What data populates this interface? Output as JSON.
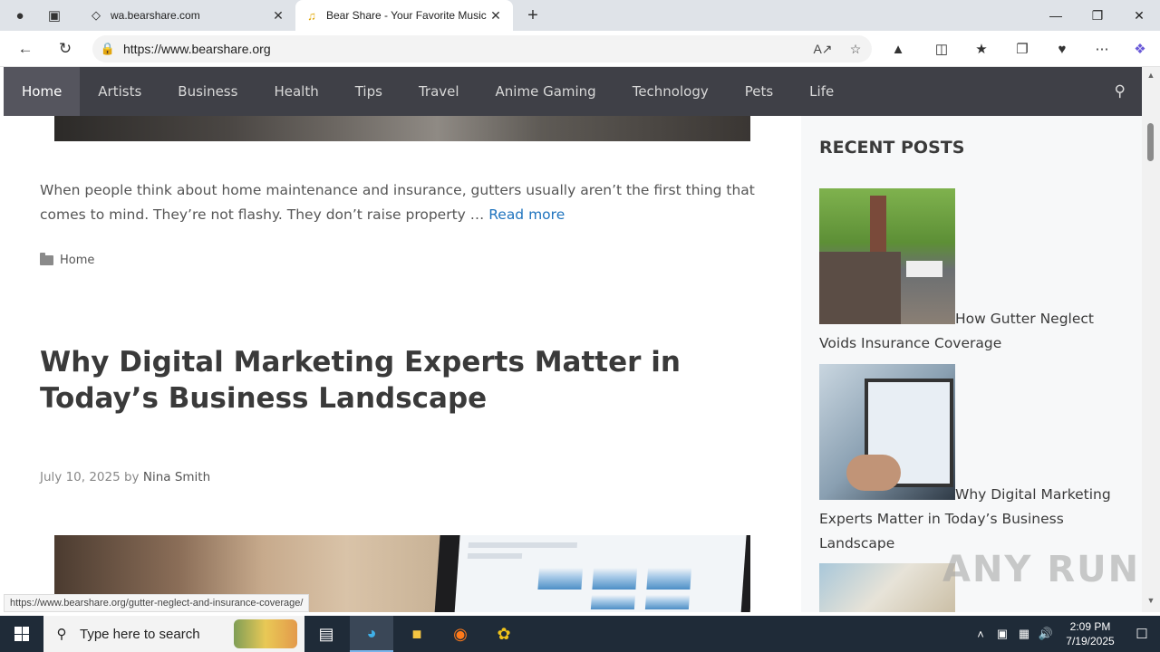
{
  "browser": {
    "tabs": [
      {
        "title": "wa.bearshare.com",
        "favicon": "page-icon",
        "active": false
      },
      {
        "title": "Bear Share - Your Favorite Music E",
        "favicon": "headphones-icon",
        "active": true
      }
    ],
    "new_tab_label": "+",
    "address": "https://www.bearshare.org",
    "status_url": "https://www.bearshare.org/gutter-neglect-and-insurance-coverage/"
  },
  "site": {
    "nav": {
      "items": [
        "Home",
        "Artists",
        "Business",
        "Health",
        "Tips",
        "Travel",
        "Anime Gaming",
        "Technology",
        "Pets",
        "Life"
      ],
      "active": "Home"
    },
    "prev_post": {
      "excerpt": "When people think about home maintenance and insurance, gutters usually aren’t the first thing that comes to mind. They’re not flashy. They don’t raise property …",
      "read_more": "Read more",
      "category": "Home"
    },
    "post": {
      "title": "Why Digital Marketing Experts Matter in Today’s Business Landscape",
      "date": "July 10, 2025",
      "by": "by",
      "author": "Nina Smith"
    },
    "sidebar": {
      "title": "RECENT POSTS",
      "posts": [
        {
          "title": "How Gutter Neglect Voids Insurance Coverage"
        },
        {
          "title": "Why Digital Marketing Experts Matter in Today’s Business Landscape"
        }
      ]
    }
  },
  "watermark": "ANY RUN",
  "taskbar": {
    "search_placeholder": "Type here to search",
    "time": "2:09 PM",
    "date": "7/19/2025"
  }
}
